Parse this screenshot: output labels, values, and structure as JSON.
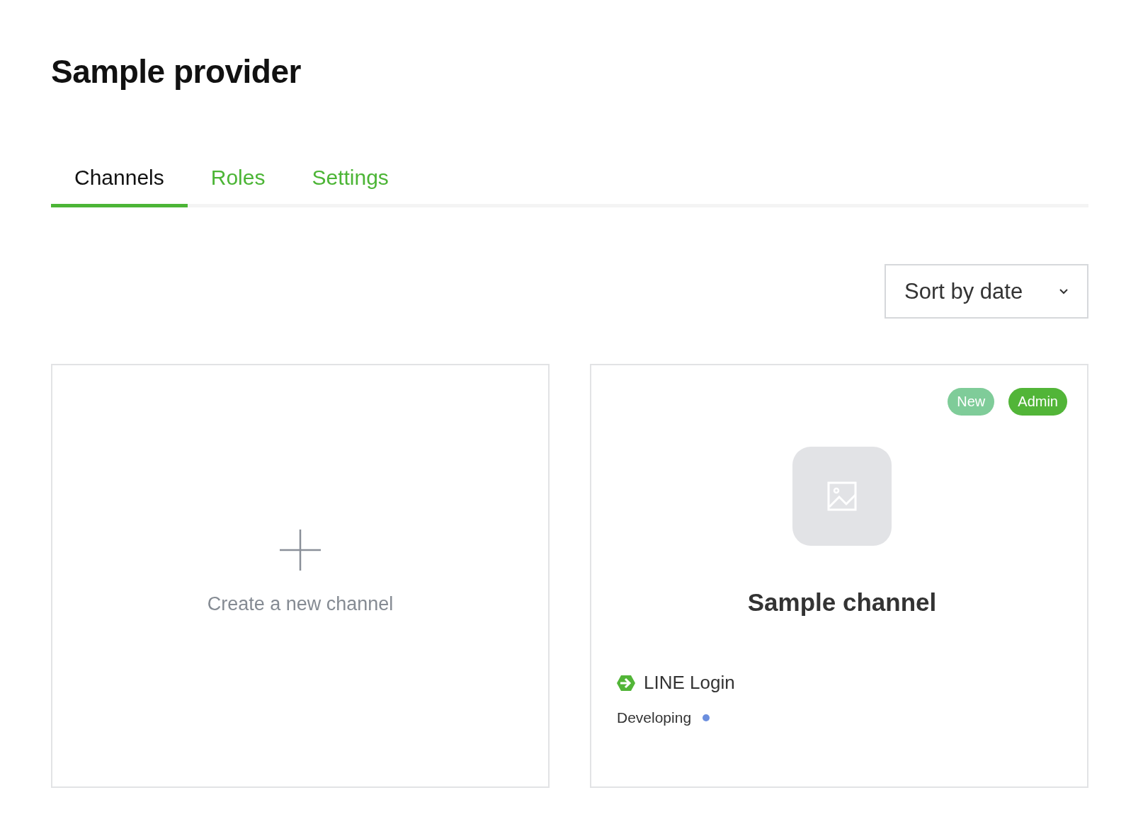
{
  "title": "Sample provider",
  "tabs": [
    {
      "label": "Channels",
      "selected": true
    },
    {
      "label": "Roles",
      "selected": false
    },
    {
      "label": "Settings",
      "selected": false
    }
  ],
  "sort": {
    "value": "Sort by date"
  },
  "create_card": {
    "label": "Create a new channel"
  },
  "channels": [
    {
      "name": "Sample channel",
      "badges": [
        {
          "label": "New",
          "color": "#7fcc99"
        },
        {
          "label": "Admin",
          "color": "#52b538"
        }
      ],
      "type": "LINE Login",
      "status": {
        "label": "Developing",
        "color": "#6b8ede"
      }
    }
  ]
}
